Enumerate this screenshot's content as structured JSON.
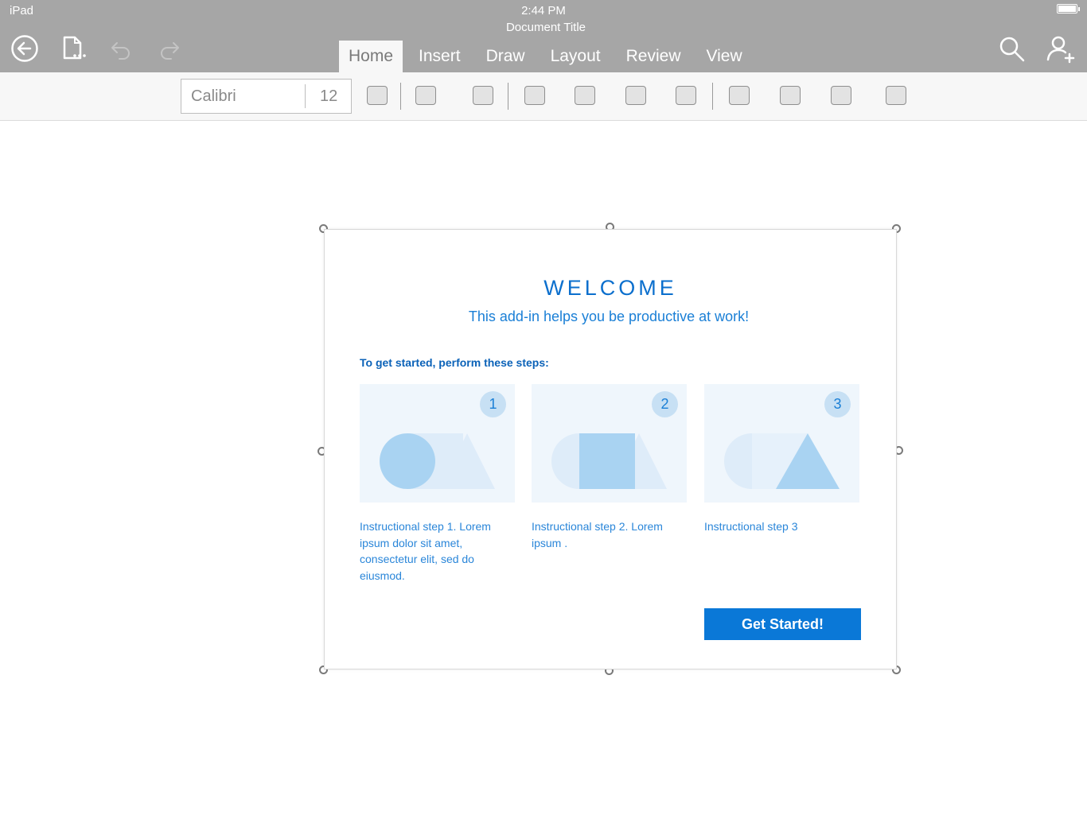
{
  "status_bar": {
    "device": "iPad",
    "time": "2:44 PM"
  },
  "document": {
    "title": "Document Title"
  },
  "toolbar": {
    "icons": [
      "back-icon",
      "file-options-icon",
      "undo-icon",
      "redo-icon",
      "search-icon",
      "add-person-icon"
    ],
    "tabs": [
      "Home",
      "Insert",
      "Draw",
      "Layout",
      "Review",
      "View"
    ],
    "active_tab": "Home"
  },
  "ribbon": {
    "font_name": "Calibri",
    "font_size": "12"
  },
  "addin": {
    "heading": "WELCOME",
    "subtitle": "This add-in helps you be productive at work!",
    "steps_heading": "To get started, perform these steps:",
    "steps": [
      {
        "number": "1",
        "text": "Instructional step 1. Lorem ipsum dolor sit amet, consectetur elit, sed do eiusmod."
      },
      {
        "number": "2",
        "text": "Instructional step 2. Lorem ipsum ."
      },
      {
        "number": "3",
        "text": "Instructional step 3"
      }
    ],
    "button_label": "Get Started!"
  },
  "colors": {
    "toolbar_bg": "#a6a6a6",
    "ribbon_bg": "#f7f7f7",
    "accent": "#0a78d7",
    "heading_blue": "#0b6fcd",
    "tile_bg": "#eff6fc",
    "shape_light": "#deecf9",
    "shape_mid": "#a9d3f2"
  }
}
